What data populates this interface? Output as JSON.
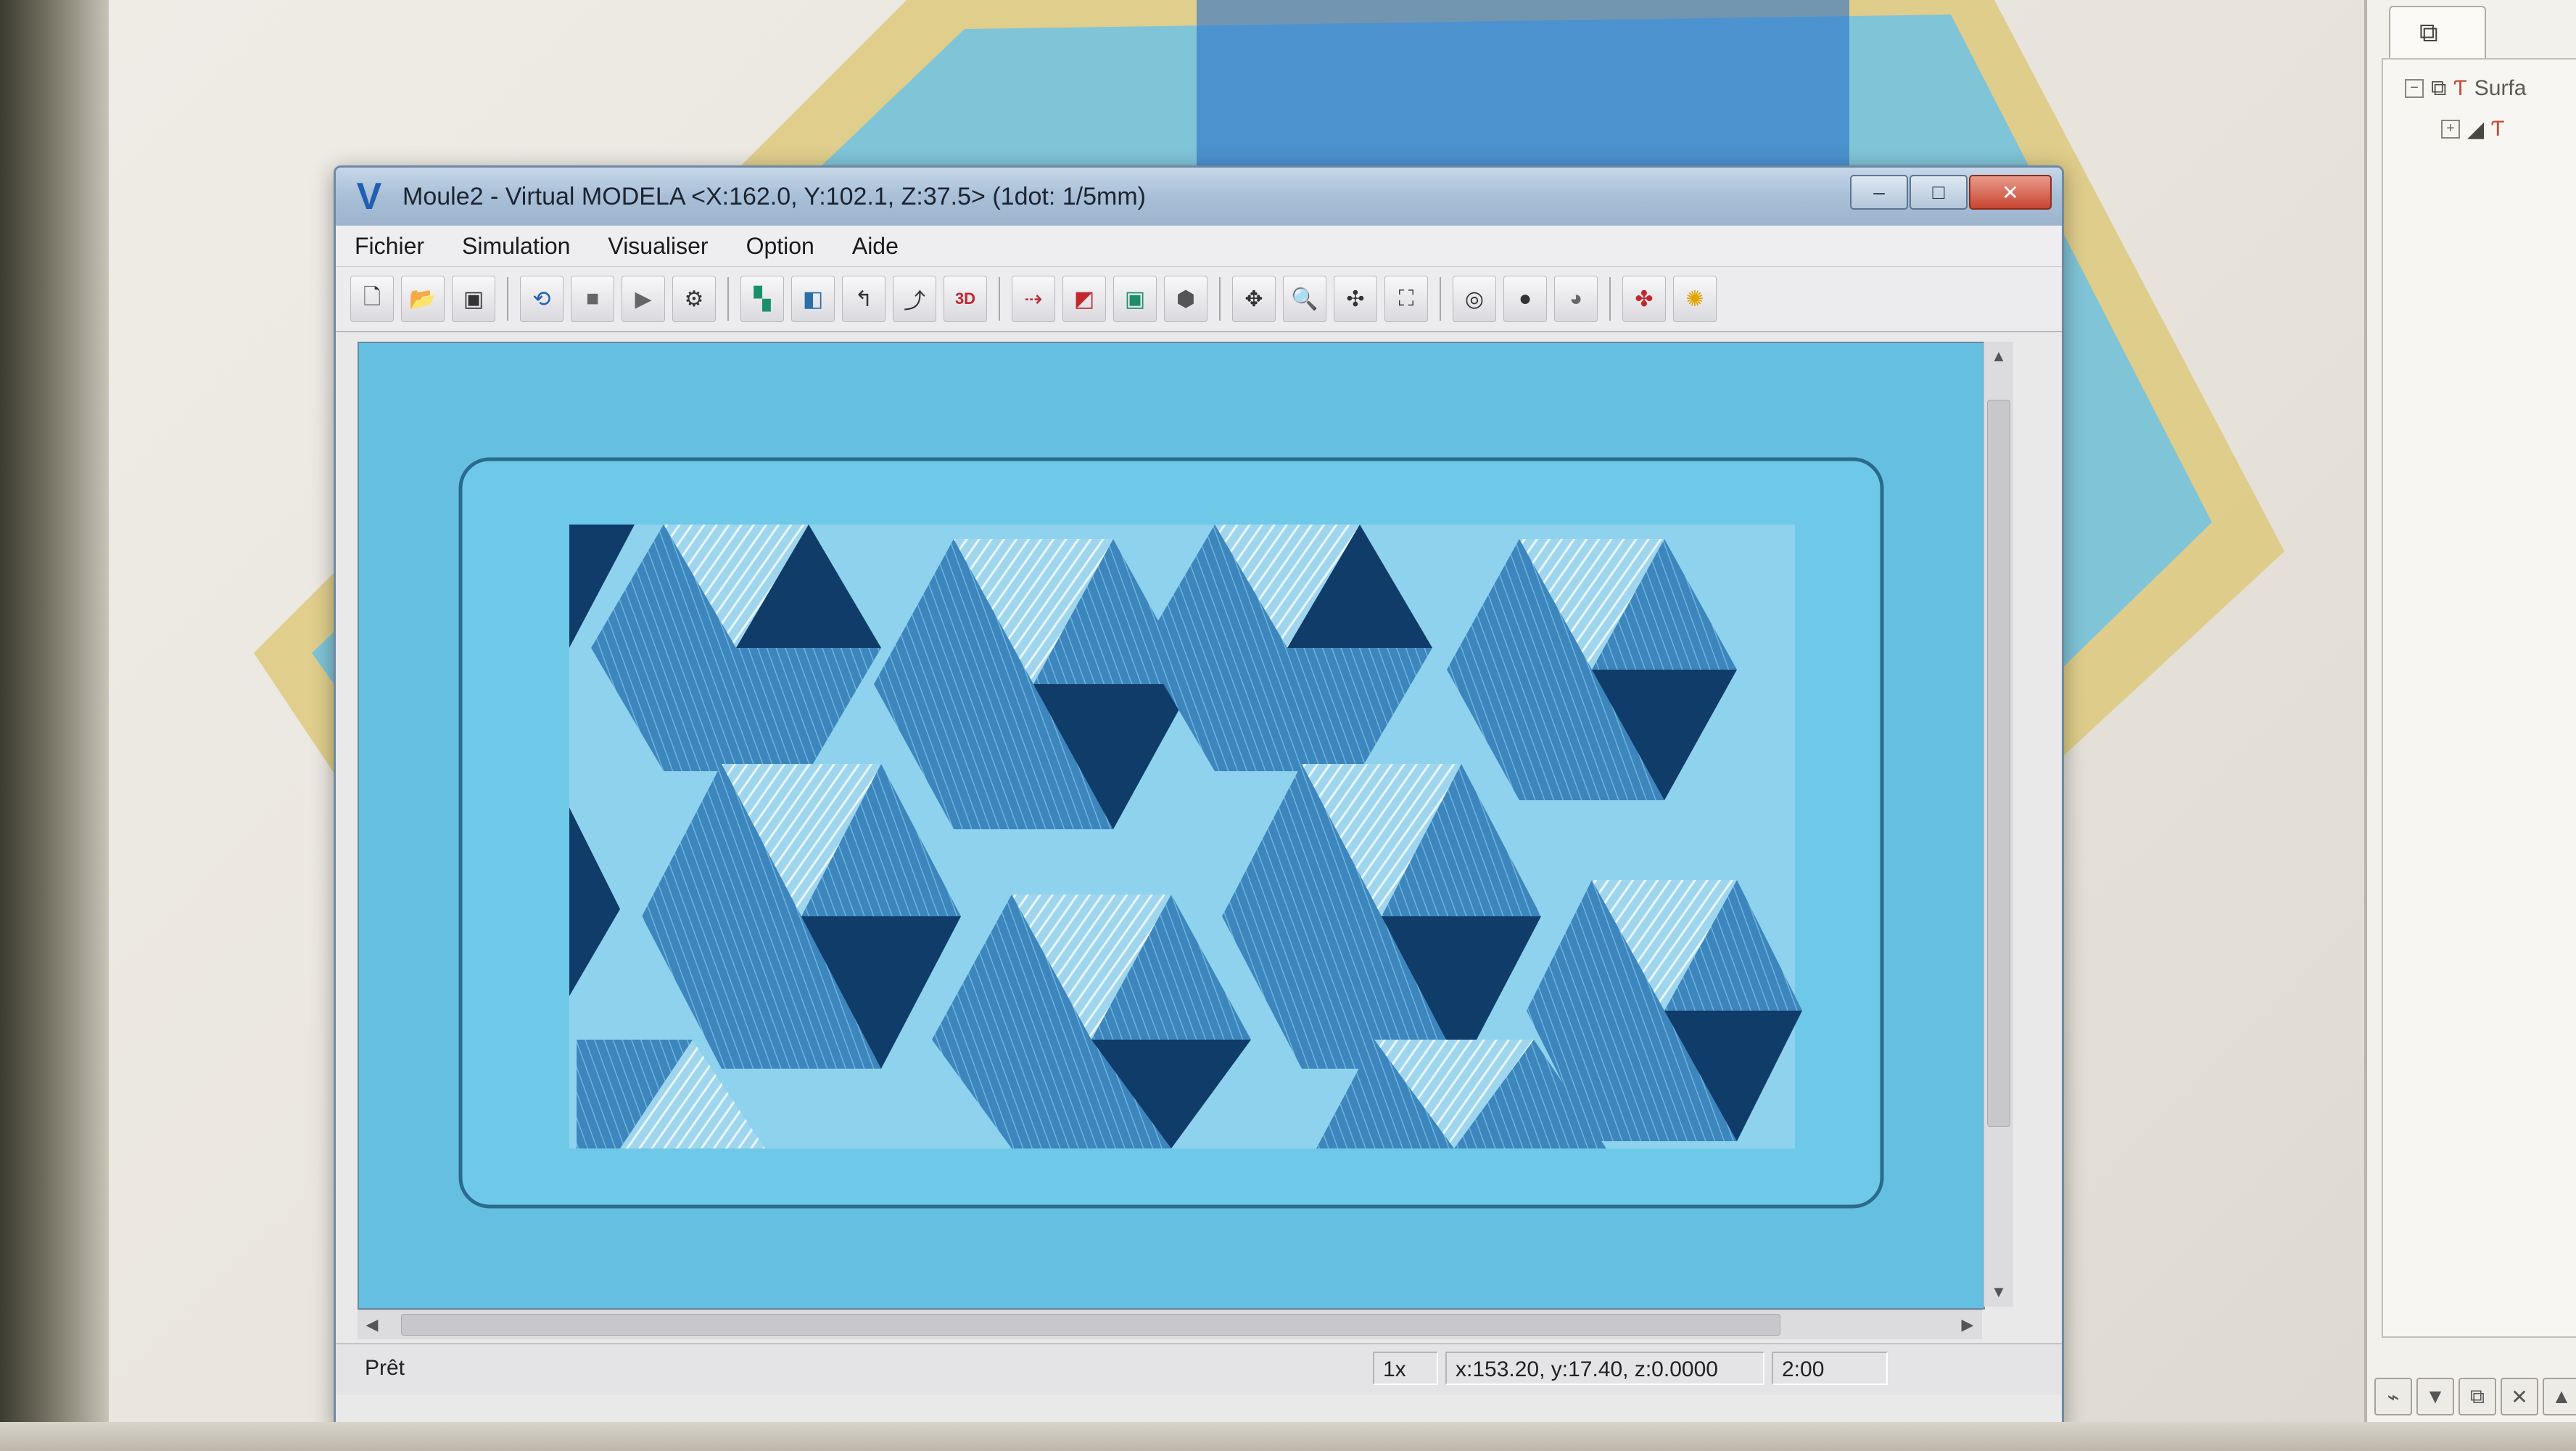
{
  "window": {
    "title": "Moule2 - Virtual MODELA <X:162.0, Y:102.1, Z:37.5> (1dot: 1/5mm)",
    "logo": "V",
    "minimize_glyph": "–",
    "maximize_glyph": "□",
    "close_glyph": "✕"
  },
  "menu": [
    "Fichier",
    "Simulation",
    "Visualiser",
    "Option",
    "Aide"
  ],
  "toolbar_icons": [
    "new-file-icon",
    "open-folder-icon",
    "save-icon",
    "reset-icon",
    "stop-icon",
    "play-icon",
    "step-icon",
    "workpiece-icon",
    "material-icon",
    "path-icon",
    "path-line-icon",
    "view-3d-icon",
    "cut-direction-icon",
    "color-icon",
    "shade-icon",
    "sphere-icon",
    "tool-move-icon",
    "tool-zoom-icon",
    "tool-pan-icon",
    "tool-fit-icon",
    "view-front-icon",
    "view-solid-icon",
    "view-sphere-icon",
    "render-icon",
    "light-icon"
  ],
  "status": {
    "ready": "Prêt",
    "zoom": "1x",
    "coords": "x:153.20, y:17.40, z:0.0000",
    "time": "2:00"
  },
  "side_panel": {
    "tree_label": "Surfa",
    "tools": [
      "⌁",
      "▼",
      "⧉",
      "✕",
      "▲"
    ]
  },
  "colors": {
    "viewport_bg": "#64bfe0",
    "relief_dark": "#0f3c68",
    "relief_mid": "#3e87bd",
    "relief_light": "#cfeaf7"
  }
}
